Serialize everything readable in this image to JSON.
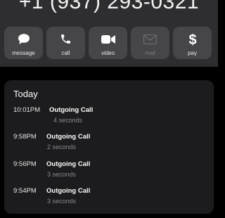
{
  "header": {
    "phone_number": "+1 (937) 293-0321"
  },
  "actions": [
    {
      "label": "message",
      "icon": "message-bubble-icon",
      "enabled": true
    },
    {
      "label": "call",
      "icon": "phone-icon",
      "enabled": true
    },
    {
      "label": "video",
      "icon": "video-camera-icon",
      "enabled": true
    },
    {
      "label": "mail",
      "icon": "envelope-icon",
      "enabled": false
    },
    {
      "label": "pay",
      "icon": "dollar-icon",
      "enabled": true
    }
  ],
  "recents": {
    "title": "Today",
    "calls": [
      {
        "time": "10:01PM",
        "type": "Outgoing Call",
        "duration": "4 seconds"
      },
      {
        "time": "9:58PM",
        "type": "Outgoing Call",
        "duration": "2 seconds"
      },
      {
        "time": "9:56PM",
        "type": "Outgoing Call",
        "duration": "3 seconds"
      },
      {
        "time": "9:54PM",
        "type": "Outgoing Call",
        "duration": "3 seconds"
      }
    ]
  },
  "colors": {
    "top_background": "#2e2e30",
    "button_background": "#464649",
    "card_background": "#1c1c1e",
    "secondary_text": "#8a8a8e"
  }
}
